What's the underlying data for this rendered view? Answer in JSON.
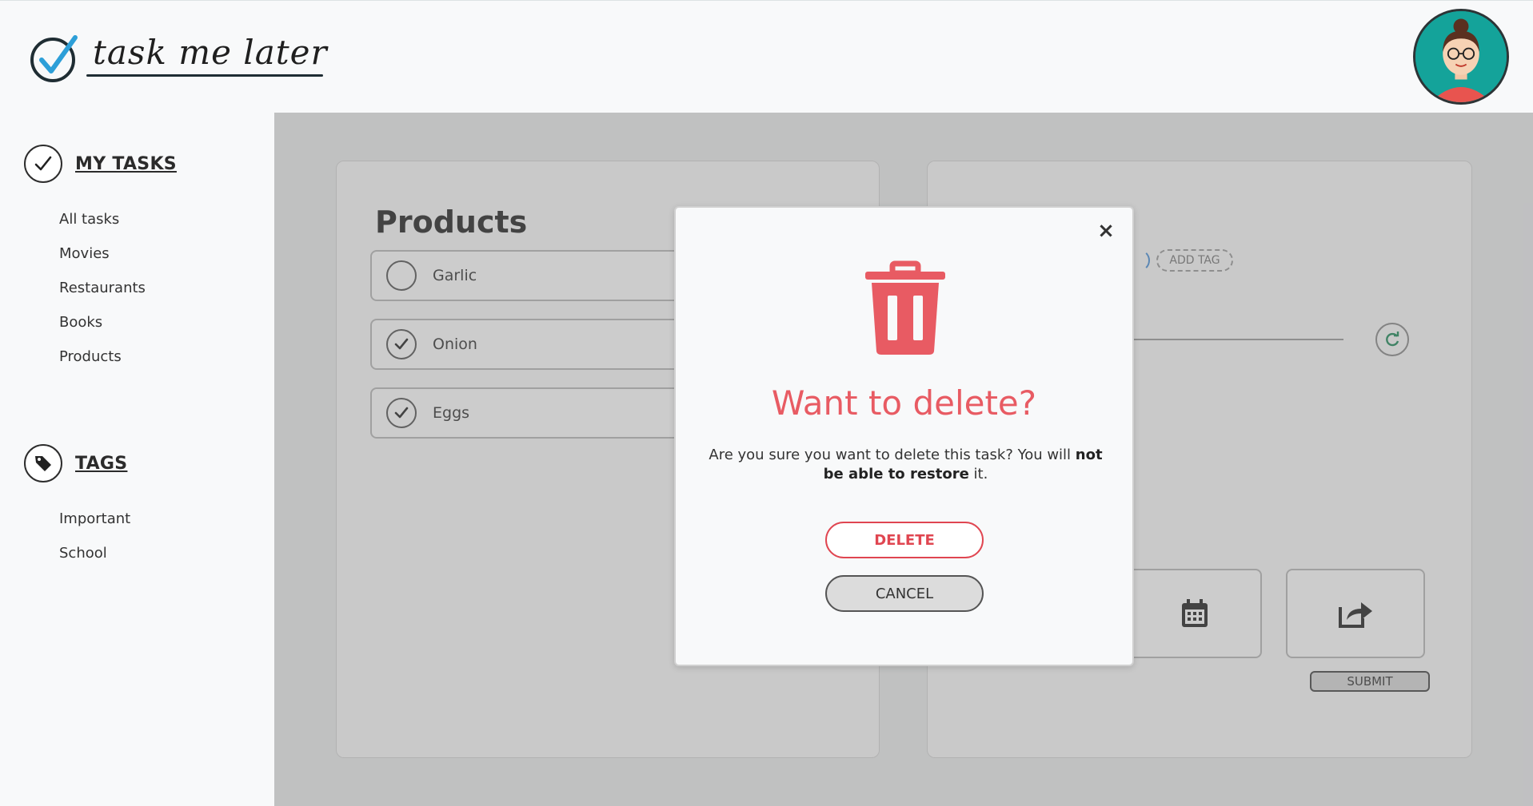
{
  "header": {
    "logo_text": "task me later"
  },
  "sidebar": {
    "tasks_title": "MY TASKS",
    "task_items": [
      "All tasks",
      "Movies",
      "Restaurants",
      "Books",
      "Products"
    ],
    "tags_title": "TAGS",
    "tag_items": [
      "Important",
      "School"
    ]
  },
  "main": {
    "list_title": "Products",
    "tasks": [
      {
        "label": "Garlic",
        "done": false
      },
      {
        "label": "Onion",
        "done": true
      },
      {
        "label": "Eggs",
        "done": true
      }
    ],
    "add_tag_label": "ADD TAG",
    "submit_label": "SUBMIT"
  },
  "modal": {
    "close_glyph": "×",
    "heading": "Want to delete?",
    "body_part1": "Are you sure you want to delete this task? You will ",
    "body_bold": "not be able to restore",
    "body_part2": " it.",
    "delete_label": "DELETE",
    "cancel_label": "CANCEL"
  },
  "colors": {
    "accent_red": "#e85b63",
    "logo_check_blue": "#2d9fd8",
    "avatar_bg": "#14a39a"
  }
}
